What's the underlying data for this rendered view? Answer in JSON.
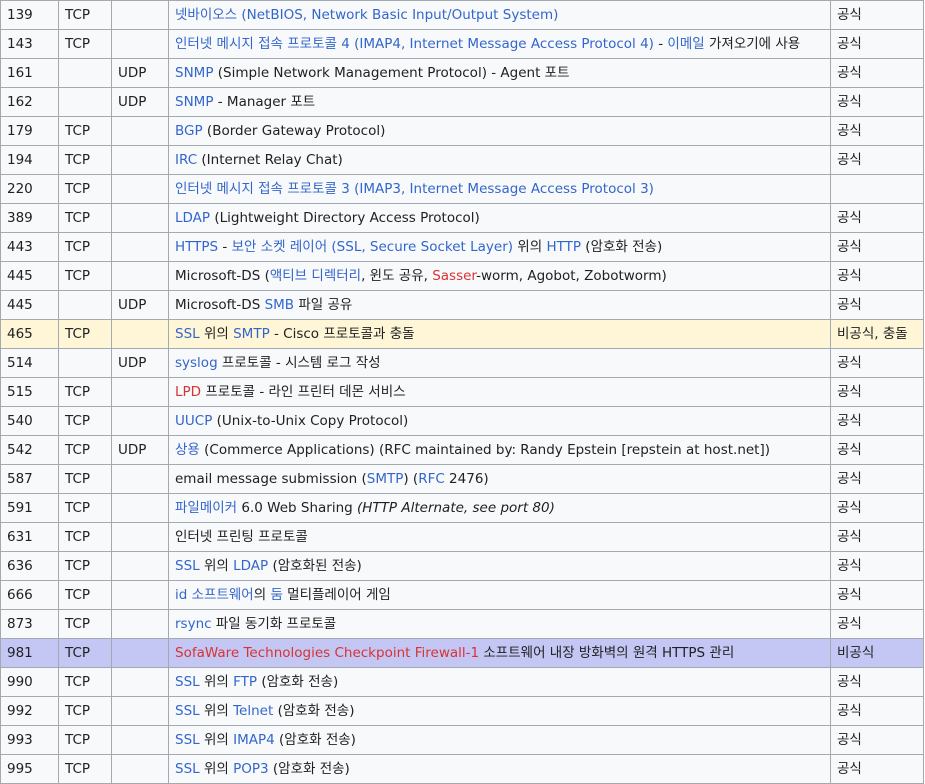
{
  "colors": {
    "link": "#3366cc",
    "redlink": "#d73333",
    "row_yellow": "#fef6d7",
    "row_purple": "#c4c7f4",
    "border": "#a2a9b1"
  },
  "rows": [
    {
      "port": "139",
      "tcp": "TCP",
      "udp": "",
      "status": "공식",
      "desc": [
        {
          "t": "넷바이오스 (NetBIOS, Network Basic Input/Output System)",
          "s": "link"
        }
      ]
    },
    {
      "port": "143",
      "tcp": "TCP",
      "udp": "",
      "status": "공식",
      "desc": [
        {
          "t": "인터넷 메시지 접속 프로토콜 4 (IMAP4, Internet Message Access Protocol 4)",
          "s": "link"
        },
        {
          "t": " - ",
          "s": ""
        },
        {
          "t": "이메일",
          "s": "link"
        },
        {
          "t": " 가져오기에 사용",
          "s": ""
        }
      ]
    },
    {
      "port": "161",
      "tcp": "",
      "udp": "UDP",
      "status": "공식",
      "desc": [
        {
          "t": "SNMP",
          "s": "link"
        },
        {
          "t": " (Simple Network Management Protocol) - Agent 포트",
          "s": ""
        }
      ]
    },
    {
      "port": "162",
      "tcp": "",
      "udp": "UDP",
      "status": "공식",
      "desc": [
        {
          "t": "SNMP",
          "s": "link"
        },
        {
          "t": " - Manager 포트",
          "s": ""
        }
      ]
    },
    {
      "port": "179",
      "tcp": "TCP",
      "udp": "",
      "status": "공식",
      "desc": [
        {
          "t": "BGP",
          "s": "link"
        },
        {
          "t": " (Border Gateway Protocol)",
          "s": ""
        }
      ]
    },
    {
      "port": "194",
      "tcp": "TCP",
      "udp": "",
      "status": "공식",
      "desc": [
        {
          "t": "IRC",
          "s": "link"
        },
        {
          "t": " (Internet Relay Chat)",
          "s": ""
        }
      ]
    },
    {
      "port": "220",
      "tcp": "TCP",
      "udp": "",
      "status": "",
      "desc": [
        {
          "t": "인터넷 메시지 접속 프로토콜 3 (IMAP3, Internet Message Access Protocol 3)",
          "s": "link"
        }
      ]
    },
    {
      "port": "389",
      "tcp": "TCP",
      "udp": "",
      "status": "공식",
      "desc": [
        {
          "t": "LDAP",
          "s": "link"
        },
        {
          "t": " (Lightweight Directory Access Protocol)",
          "s": ""
        }
      ]
    },
    {
      "port": "443",
      "tcp": "TCP",
      "udp": "",
      "status": "공식",
      "desc": [
        {
          "t": "HTTPS",
          "s": "link"
        },
        {
          "t": " - ",
          "s": ""
        },
        {
          "t": "보안 소켓 레이어 (SSL, Secure Socket Layer)",
          "s": "link"
        },
        {
          "t": " 위의 ",
          "s": ""
        },
        {
          "t": "HTTP",
          "s": "link"
        },
        {
          "t": " (암호화 전송)",
          "s": ""
        }
      ]
    },
    {
      "port": "445",
      "tcp": "TCP",
      "udp": "",
      "status": "공식",
      "desc": [
        {
          "t": "Microsoft-DS (",
          "s": ""
        },
        {
          "t": "액티브 디렉터리",
          "s": "link"
        },
        {
          "t": ", 윈도 공유, ",
          "s": ""
        },
        {
          "t": "Sasser",
          "s": "redlink"
        },
        {
          "t": "-worm, Agobot, Zobotworm)",
          "s": ""
        }
      ]
    },
    {
      "port": "445",
      "tcp": "",
      "udp": "UDP",
      "status": "공식",
      "desc": [
        {
          "t": "Microsoft-DS ",
          "s": ""
        },
        {
          "t": "SMB",
          "s": "link"
        },
        {
          "t": " 파일 공유",
          "s": ""
        }
      ]
    },
    {
      "port": "465",
      "tcp": "TCP",
      "udp": "",
      "status": "비공식, 충돌",
      "hl": "yellow",
      "desc": [
        {
          "t": "SSL",
          "s": "link"
        },
        {
          "t": " 위의 ",
          "s": ""
        },
        {
          "t": "SMTP",
          "s": "link"
        },
        {
          "t": " - Cisco 프로토콜과 충돌",
          "s": ""
        }
      ]
    },
    {
      "port": "514",
      "tcp": "",
      "udp": "UDP",
      "status": "공식",
      "desc": [
        {
          "t": "syslog",
          "s": "link"
        },
        {
          "t": " 프로토콜 - 시스템 로그 작성",
          "s": ""
        }
      ]
    },
    {
      "port": "515",
      "tcp": "TCP",
      "udp": "",
      "status": "공식",
      "desc": [
        {
          "t": "LPD",
          "s": "redlink"
        },
        {
          "t": " 프로토콜 - 라인 프린터 데몬 서비스",
          "s": ""
        }
      ]
    },
    {
      "port": "540",
      "tcp": "TCP",
      "udp": "",
      "status": "공식",
      "desc": [
        {
          "t": "UUCP",
          "s": "link"
        },
        {
          "t": " (Unix-to-Unix Copy Protocol)",
          "s": ""
        }
      ]
    },
    {
      "port": "542",
      "tcp": "TCP",
      "udp": "UDP",
      "status": "공식",
      "desc": [
        {
          "t": "상용",
          "s": "link"
        },
        {
          "t": " (Commerce Applications) (RFC maintained by: Randy Epstein [repstein at host.net])",
          "s": ""
        }
      ]
    },
    {
      "port": "587",
      "tcp": "TCP",
      "udp": "",
      "status": "공식",
      "desc": [
        {
          "t": "email message submission (",
          "s": ""
        },
        {
          "t": "SMTP",
          "s": "link"
        },
        {
          "t": ") (",
          "s": ""
        },
        {
          "t": "RFC",
          "s": "link"
        },
        {
          "t": " 2476)",
          "s": ""
        }
      ]
    },
    {
      "port": "591",
      "tcp": "TCP",
      "udp": "",
      "status": "공식",
      "desc": [
        {
          "t": "파일메이커",
          "s": "link"
        },
        {
          "t": " 6.0 Web Sharing ",
          "s": ""
        },
        {
          "t": "(HTTP Alternate, see port 80)",
          "s": "it"
        }
      ]
    },
    {
      "port": "631",
      "tcp": "TCP",
      "udp": "",
      "status": "공식",
      "desc": [
        {
          "t": "인터넷 프린팅 프로토콜",
          "s": ""
        }
      ]
    },
    {
      "port": "636",
      "tcp": "TCP",
      "udp": "",
      "status": "공식",
      "desc": [
        {
          "t": "SSL",
          "s": "link"
        },
        {
          "t": " 위의 ",
          "s": ""
        },
        {
          "t": "LDAP",
          "s": "link"
        },
        {
          "t": " (암호화된 전송)",
          "s": ""
        }
      ]
    },
    {
      "port": "666",
      "tcp": "TCP",
      "udp": "",
      "status": "공식",
      "desc": [
        {
          "t": "id 소프트웨어",
          "s": "link"
        },
        {
          "t": "의 ",
          "s": ""
        },
        {
          "t": "둠",
          "s": "link"
        },
        {
          "t": " 멀티플레이어 게임",
          "s": ""
        }
      ]
    },
    {
      "port": "873",
      "tcp": "TCP",
      "udp": "",
      "status": "공식",
      "desc": [
        {
          "t": "rsync",
          "s": "link"
        },
        {
          "t": " 파일 동기화 프로토콜",
          "s": ""
        }
      ]
    },
    {
      "port": "981",
      "tcp": "TCP",
      "udp": "",
      "status": "비공식",
      "hl": "purple",
      "desc": [
        {
          "t": "SofaWare Technologies Checkpoint Firewall-1",
          "s": "redlink"
        },
        {
          "t": " 소프트웨어 내장 방화벽의 원격 HTTPS 관리",
          "s": ""
        }
      ]
    },
    {
      "port": "990",
      "tcp": "TCP",
      "udp": "",
      "status": "공식",
      "desc": [
        {
          "t": "SSL",
          "s": "link"
        },
        {
          "t": " 위의 ",
          "s": ""
        },
        {
          "t": "FTP",
          "s": "link"
        },
        {
          "t": " (암호화 전송)",
          "s": ""
        }
      ]
    },
    {
      "port": "992",
      "tcp": "TCP",
      "udp": "",
      "status": "공식",
      "desc": [
        {
          "t": "SSL",
          "s": "link"
        },
        {
          "t": " 위의 ",
          "s": ""
        },
        {
          "t": "Telnet",
          "s": "link"
        },
        {
          "t": " (암호화 전송)",
          "s": ""
        }
      ]
    },
    {
      "port": "993",
      "tcp": "TCP",
      "udp": "",
      "status": "공식",
      "desc": [
        {
          "t": "SSL",
          "s": "link"
        },
        {
          "t": " 위의 ",
          "s": ""
        },
        {
          "t": "IMAP4",
          "s": "link"
        },
        {
          "t": " (암호화 전송)",
          "s": ""
        }
      ]
    },
    {
      "port": "995",
      "tcp": "TCP",
      "udp": "",
      "status": "공식",
      "desc": [
        {
          "t": "SSL",
          "s": "link"
        },
        {
          "t": " 위의 ",
          "s": ""
        },
        {
          "t": "POP3",
          "s": "link"
        },
        {
          "t": " (암호화 전송)",
          "s": ""
        }
      ]
    }
  ]
}
